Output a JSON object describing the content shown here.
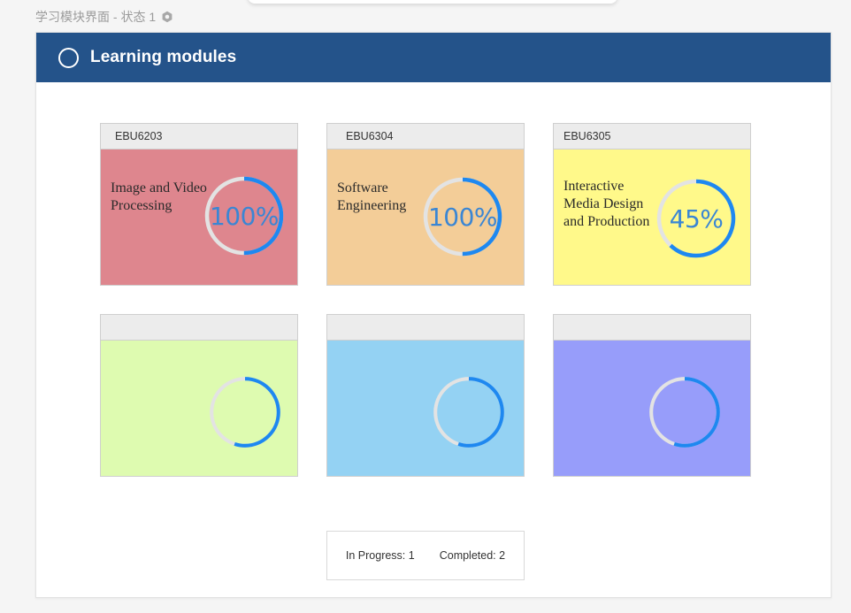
{
  "breadcrumb": {
    "text": "学习模块界面 - 状态 1",
    "icon": "gear-icon"
  },
  "header": {
    "title": "Learning modules",
    "icon": "circle-icon"
  },
  "colors": {
    "header_bg": "#24538a",
    "ring_progress": "#1e88f0",
    "ring_track": "#e3e3e3",
    "percent_text": "#3a86d4"
  },
  "modules": [
    {
      "code": "EBU6203",
      "name": "Image and Video Processing",
      "progress_text": "100%",
      "progress": 0.5,
      "color": "#de868e"
    },
    {
      "code": "EBU6304",
      "name": "Software Engineering",
      "progress_text": "100%",
      "progress": 0.5,
      "color": "#f3cd98"
    },
    {
      "code": "EBU6305",
      "name": "Interactive Media Design and Production",
      "progress_text": "45%",
      "progress": 0.62,
      "color": "#fff98a"
    },
    {
      "code": "",
      "name": "",
      "progress_text": "",
      "progress": 0.55,
      "color": "#defbb0"
    },
    {
      "code": "",
      "name": "",
      "progress_text": "",
      "progress": 0.55,
      "color": "#94d2f3"
    },
    {
      "code": "",
      "name": "",
      "progress_text": "",
      "progress": 0.55,
      "color": "#979dfa"
    }
  ],
  "summary": {
    "in_progress_label": "In Progress:",
    "in_progress_value": "1",
    "completed_label": "Completed:",
    "completed_value": "2"
  }
}
